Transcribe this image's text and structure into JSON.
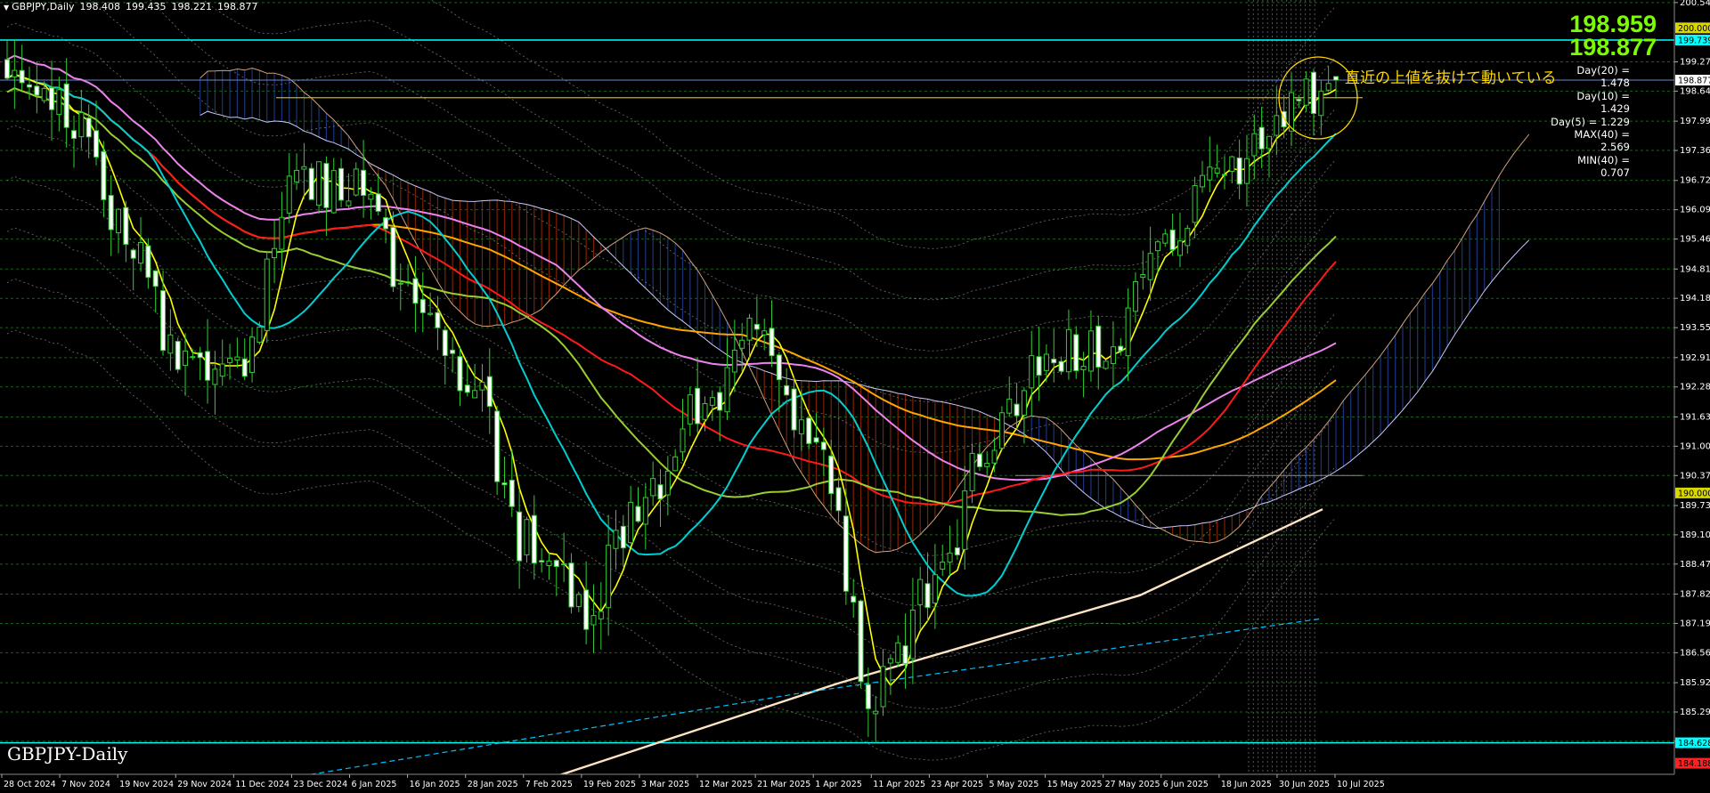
{
  "header": {
    "symbol": "GBPJPY,Daily",
    "ohlc": [
      "198.408",
      "199.435",
      "198.221",
      "198.877"
    ]
  },
  "chart_label": "GBPJPY-Daily",
  "big_prices": [
    "198.959",
    "198.877"
  ],
  "annotation": "直近の上値を抜けて動いている",
  "stats": [
    "Day(20) = 1.478",
    "Day(10) = 1.429",
    "Day(5) = 1.229",
    "MAX(40) = 2.569",
    "MIN(40) = 0.707"
  ],
  "price_axis": {
    "ticks": [
      "200.545",
      "199.270",
      "198.640",
      "197.995",
      "197.365",
      "196.720",
      "196.090",
      "195.460",
      "194.815",
      "194.185",
      "193.555",
      "192.910",
      "192.280",
      "191.635",
      "191.005",
      "190.375",
      "189.730",
      "189.100",
      "188.470",
      "187.825",
      "187.195",
      "186.565",
      "185.920",
      "185.290",
      "184.660"
    ],
    "boxes": [
      {
        "label": "200.000",
        "value": 200.0,
        "bg": "#D8D800",
        "fg": "#000000"
      },
      {
        "label": "199.739",
        "value": 199.739,
        "bg": "#00FFFF",
        "fg": "#000000"
      },
      {
        "label": "198.877",
        "value": 198.877,
        "bg": "#FFFFFF",
        "fg": "#000000"
      },
      {
        "label": "190.000",
        "value": 190.0,
        "bg": "#D8D800",
        "fg": "#000000"
      },
      {
        "label": "184.628",
        "value": 184.628,
        "bg": "#00FFFF",
        "fg": "#000000"
      },
      {
        "label": "184.188",
        "value": 184.188,
        "bg": "#FF2020",
        "fg": "#000000"
      }
    ]
  },
  "date_axis": [
    "28 Oct 2024",
    "7 Nov 2024",
    "19 Nov 2024",
    "29 Nov 2024",
    "11 Dec 2024",
    "23 Dec 2024",
    "6 Jan 2025",
    "16 Jan 2025",
    "28 Jan 2025",
    "7 Feb 2025",
    "19 Feb 2025",
    "3 Mar 2025",
    "12 Mar 2025",
    "21 Mar 2025",
    "1 Apr 2025",
    "11 Apr 2025",
    "23 Apr 2025",
    "5 May 2025",
    "15 May 2025",
    "27 May 2025",
    "6 Jun 2025",
    "18 Jun 2025",
    "30 Jun 2025",
    "10 Jul 2025"
  ],
  "colors": {
    "background": "#000000",
    "bull_candle": "#32CD32",
    "bear_candle": "#FFFFFF",
    "ma_short": "#FFFF00",
    "ma_mid": "#00CED1",
    "ma_red": "#FF1A1A",
    "ma_orange": "#FFA500",
    "ma_violet": "#EE82EE",
    "ma_olive": "#9ACD32",
    "ma_long": "#FFE4C4",
    "cloud_bull": "#1E3A8A",
    "cloud_bear": "#8B2500",
    "hline_cyan": "#00FFFF",
    "hline_yellow": "#D8D800"
  },
  "chart_data": {
    "type": "candlestick",
    "symbol": "GBPJPY",
    "timeframe": "Daily",
    "ylim": [
      183.95,
      200.6
    ],
    "x": [
      "28 Oct 2024",
      "7 Nov 2024",
      "19 Nov 2024",
      "29 Nov 2024",
      "11 Dec 2024",
      "23 Dec 2024",
      "6 Jan 2025",
      "16 Jan 2025",
      "28 Jan 2025",
      "7 Feb 2025",
      "19 Feb 2025",
      "3 Mar 2025",
      "12 Mar 2025",
      "21 Mar 2025",
      "1 Apr 2025",
      "11 Apr 2025",
      "23 Apr 2025",
      "5 May 2025",
      "15 May 2025",
      "27 May 2025",
      "6 Jun 2025",
      "18 Jun 2025",
      "30 Jun 2025",
      "10 Jul 2025"
    ],
    "series": [
      {
        "values": [
          198.9,
          198.2,
          195.8,
          193.0,
          192.8,
          196.8,
          196.5,
          194.2,
          192.3,
          188.9,
          187.6,
          189.7,
          191.8,
          193.4,
          191.1,
          185.6,
          187.8,
          191.0,
          193.0,
          193.2,
          195.2,
          196.7,
          198.2,
          198.877
        ]
      }
    ],
    "horizontal_levels": [
      200.0,
      199.739,
      198.877,
      190.0,
      184.628,
      184.188
    ]
  }
}
